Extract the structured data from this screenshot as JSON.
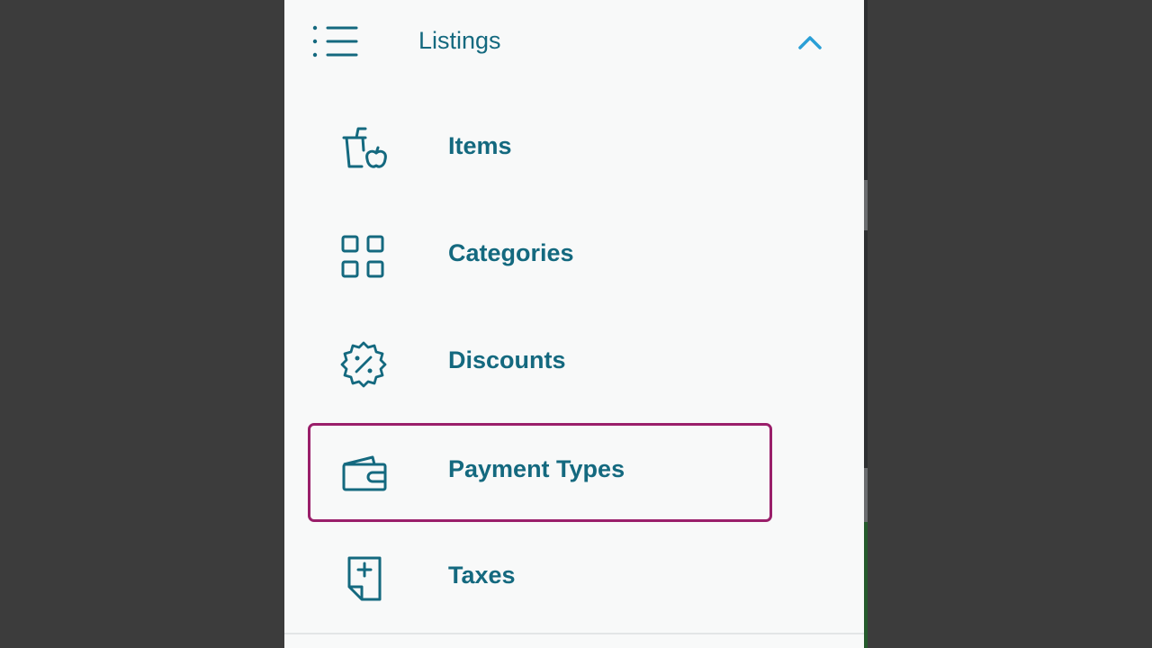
{
  "colors": {
    "accent": "#14697f",
    "chevron": "#2a9fd6",
    "highlight_border": "#9a1f6a",
    "panel_bg": "#f8f9f9",
    "backdrop": "#3c3c3c"
  },
  "header": {
    "title": "Listings",
    "icon": "list-icon",
    "toggle_icon": "chevron-up-icon",
    "expanded": true
  },
  "menu": {
    "items": [
      {
        "label": "Items",
        "icon": "drink-apple-icon",
        "selected": false
      },
      {
        "label": "Categories",
        "icon": "grid-icon",
        "selected": false
      },
      {
        "label": "Discounts",
        "icon": "discount-badge-icon",
        "selected": false
      },
      {
        "label": "Payment Types",
        "icon": "wallet-icon",
        "selected": true
      },
      {
        "label": "Taxes",
        "icon": "tax-document-icon",
        "selected": false
      }
    ]
  }
}
